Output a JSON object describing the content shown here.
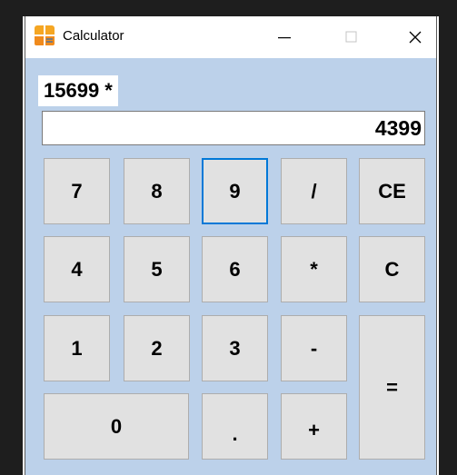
{
  "window": {
    "title": "Calculator",
    "minimize_glyph": "—",
    "maximize_glyph": "☐",
    "close_glyph": "✕",
    "icon": "calculator-app-icon"
  },
  "calculator": {
    "expression": "15699 *",
    "display_value": "4399",
    "keys": {
      "k7": "7",
      "k8": "8",
      "k9": "9",
      "divide": "/",
      "ce": "CE",
      "k4": "4",
      "k5": "5",
      "k6": "6",
      "multiply": "*",
      "clear": "C",
      "k1": "1",
      "k2": "2",
      "k3": "3",
      "subtract": "-",
      "equals": "=",
      "k0": "0",
      "decimal": ".",
      "add": "+"
    },
    "focused_key": "9"
  },
  "colors": {
    "client_background": "#bcd1ea",
    "button_face": "#e1e1e1",
    "focus_border": "#0078d7",
    "icon_orange": "#f5a623"
  }
}
